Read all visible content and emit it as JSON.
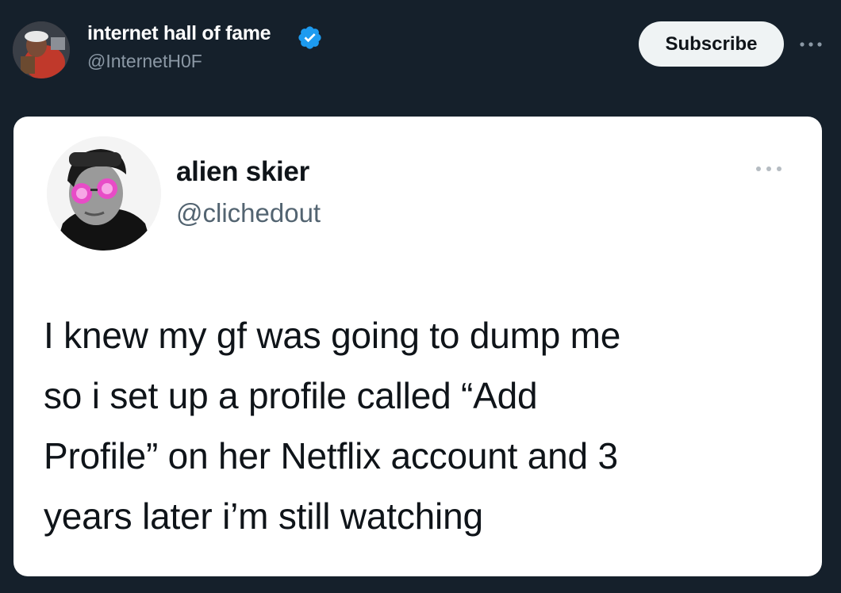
{
  "post": {
    "display_name": "internet hall of fame",
    "handle": "@InternetH0F",
    "verified": true,
    "subscribe_label": "Subscribe",
    "more_icon": "more-horizontal-icon",
    "accent_color": "#1d9bf0"
  },
  "embedded_tweet": {
    "display_name": "alien skier",
    "handle": "@clichedout",
    "more_icon": "more-horizontal-icon",
    "text_lines": [
      "I knew my gf was going to dump me",
      "so i set up a profile called “Add",
      "Profile” on her Netflix account and 3",
      "years later i’m still watching"
    ]
  }
}
